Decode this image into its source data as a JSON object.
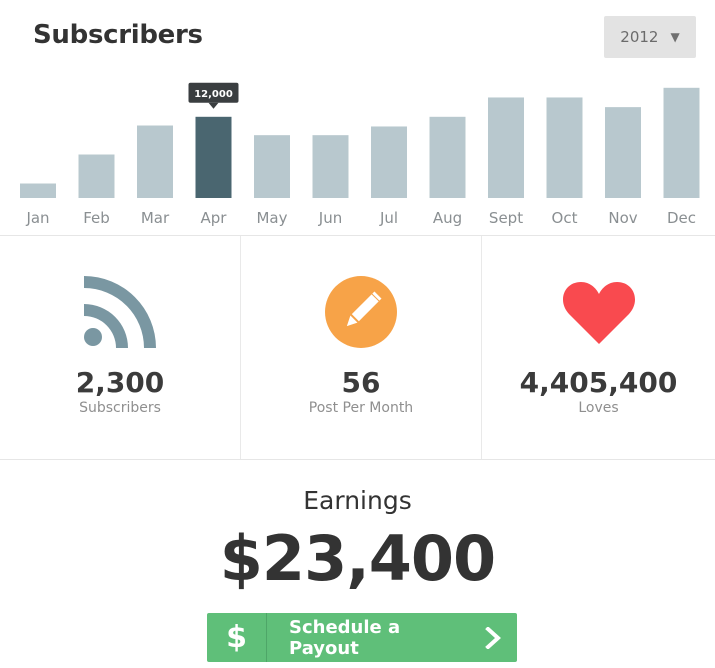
{
  "header": {
    "title": "Subscribers",
    "year_selected": "2012"
  },
  "chart_data": {
    "type": "bar",
    "categories": [
      "Jan",
      "Feb",
      "Mar",
      "Apr",
      "May",
      "Jun",
      "Jul",
      "Aug",
      "Sept",
      "Oct",
      "Nov",
      "Dec"
    ],
    "values": [
      1500,
      4500,
      7500,
      8400,
      6500,
      6500,
      7400,
      8400,
      10400,
      10400,
      9400,
      11400
    ],
    "highlight_index": 3,
    "highlight_label": "12,000",
    "ylim": [
      0,
      12000
    ],
    "colors": {
      "bar": "#b8c8ce",
      "highlight": "#4a6670"
    },
    "grid": false
  },
  "stats": [
    {
      "value": "2,300",
      "label": "Subscribers",
      "icon": "rss-icon",
      "color": "#7a97a2"
    },
    {
      "value": "56",
      "label": "Post Per Month",
      "icon": "pencil-icon",
      "color": "#f7a348"
    },
    {
      "value": "4,405,400",
      "label": "Loves",
      "icon": "heart-icon",
      "color": "#f94a4f"
    }
  ],
  "earnings": {
    "title": "Earnings",
    "value": "$23,400"
  },
  "payout_button": {
    "icon_text": "$",
    "label": "Schedule a Payout",
    "color": "#5fbf79"
  }
}
